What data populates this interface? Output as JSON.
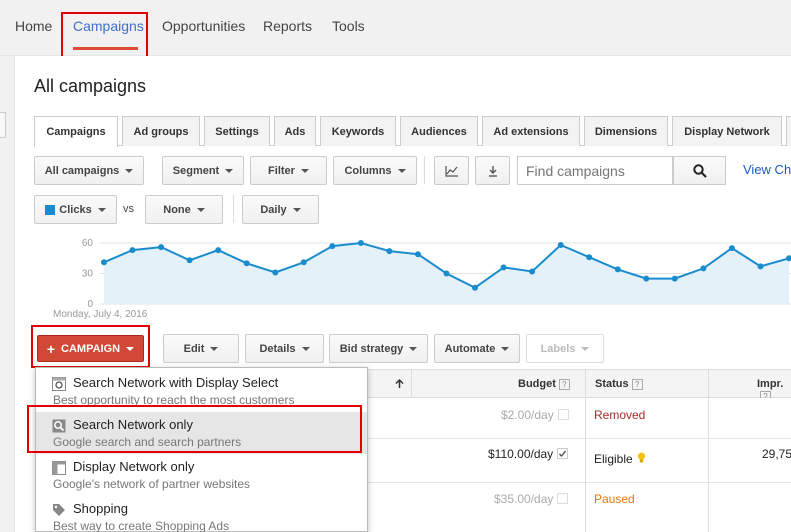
{
  "nav": {
    "items": [
      "Home",
      "Campaigns",
      "Opportunities",
      "Reports",
      "Tools"
    ],
    "active": "Campaigns"
  },
  "page_title": "All campaigns",
  "tabs": [
    "Campaigns",
    "Ad groups",
    "Settings",
    "Ads",
    "Keywords",
    "Audiences",
    "Ad extensions",
    "Dimensions",
    "Display Network"
  ],
  "toolbar": {
    "all_campaigns": "All campaigns",
    "segment": "Segment",
    "filter": "Filter",
    "columns": "Columns",
    "search_placeholder": "Find campaigns",
    "view_link": "View Ch"
  },
  "metrics": {
    "primary": "Clicks",
    "vs": "vs",
    "secondary": "None",
    "period": "Daily"
  },
  "chart_data": {
    "type": "area",
    "ylim": [
      0,
      60
    ],
    "yticks": [
      "60",
      "30",
      "0"
    ],
    "xlabel_first": "Monday, July 4, 2016",
    "series": [
      {
        "values": [
          41,
          53,
          56,
          43,
          53,
          40,
          31,
          41,
          57,
          60,
          52,
          49,
          30,
          16,
          36,
          32,
          58,
          46,
          34,
          25,
          25,
          35,
          55,
          37,
          45
        ]
      }
    ],
    "colors": {
      "line": "#1a8cce",
      "fill": "#e4f1f8"
    }
  },
  "actions": {
    "campaign": "CAMPAIGN",
    "edit": "Edit",
    "details": "Details",
    "bid_strategy": "Bid strategy",
    "automate": "Automate",
    "labels": "Labels"
  },
  "table": {
    "columns": [
      "Budget",
      "Status",
      "Impr."
    ],
    "rows": [
      {
        "budget": "$2.00/day",
        "status": "Removed",
        "impr": ""
      },
      {
        "budget": "$110.00/day",
        "status": "Eligible",
        "impr": "29,75"
      },
      {
        "budget": "$35.00/day",
        "status": "Paused",
        "impr": ""
      }
    ]
  },
  "dropdown": {
    "items": [
      {
        "title": "Search Network with Display Select",
        "subtitle": "Best opportunity to reach the most customers"
      },
      {
        "title": "Search Network only",
        "subtitle": "Google search and search partners"
      },
      {
        "title": "Display Network only",
        "subtitle": "Google's network of partner websites"
      },
      {
        "title": "Shopping",
        "subtitle": "Best way to create Shopping Ads"
      }
    ]
  },
  "colors": {
    "accent_red": "#d14836",
    "nav_active": "#3f6fd1",
    "removed": "#a52a2a",
    "paused": "#e8760a",
    "highlight_box": "#e00000"
  }
}
